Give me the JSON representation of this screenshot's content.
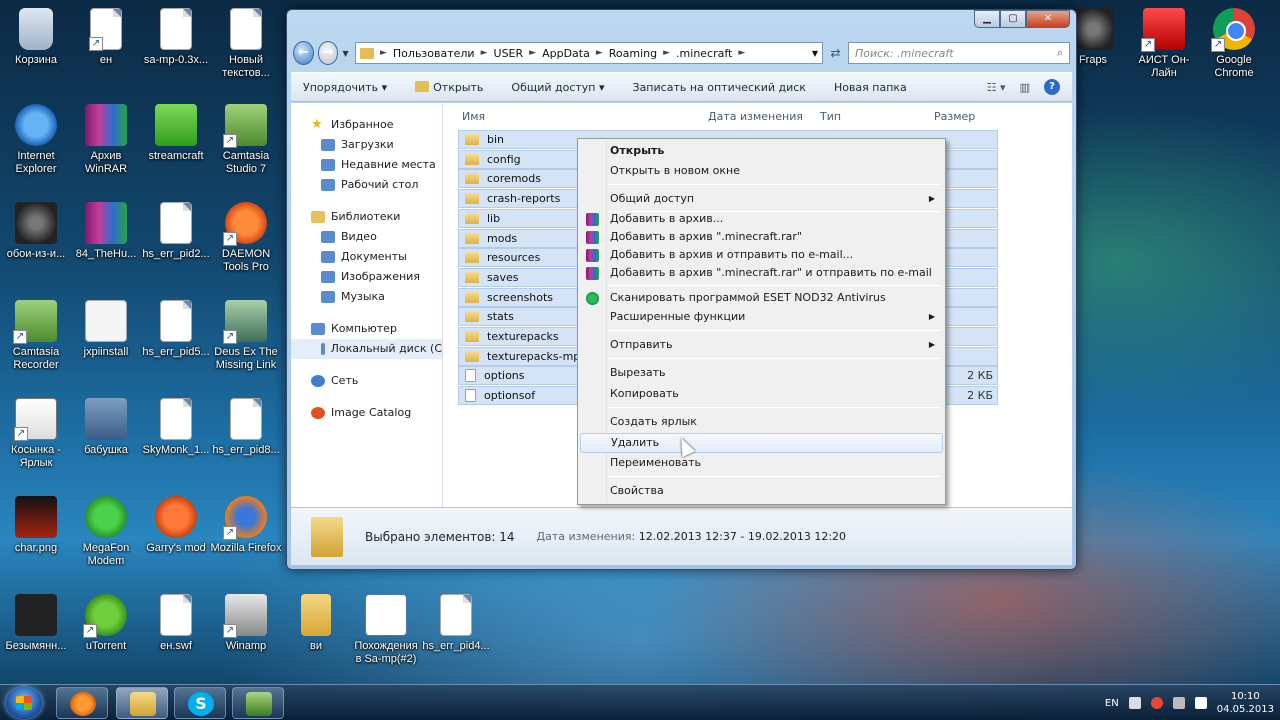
{
  "desktop": {
    "icons": [
      {
        "label": "Корзина"
      },
      {
        "label": "ен"
      },
      {
        "label": "sa-mp-0.3x..."
      },
      {
        "label": "Новый текстов..."
      },
      {
        "label": "Internet Explorer"
      },
      {
        "label": "Архив WinRAR"
      },
      {
        "label": "streamcraft"
      },
      {
        "label": "Camtasia Studio 7"
      },
      {
        "label": "обои-из-и..."
      },
      {
        "label": "84_TheHu..."
      },
      {
        "label": "hs_err_pid2..."
      },
      {
        "label": "DAEMON Tools Pro"
      },
      {
        "label": "Camtasia Recorder"
      },
      {
        "label": "jxpiinstall"
      },
      {
        "label": "hs_err_pid5..."
      },
      {
        "label": "Deus Ex The Missing Link"
      },
      {
        "label": "Косынка - Ярлык"
      },
      {
        "label": "бабушка"
      },
      {
        "label": "SkyMonk_1..."
      },
      {
        "label": "hs_err_pid8..."
      },
      {
        "label": "char.png"
      },
      {
        "label": "MegaFon Modem"
      },
      {
        "label": "Garry's mod"
      },
      {
        "label": "Mozilla Firefox"
      },
      {
        "label": "Безымянн..."
      },
      {
        "label": "uTorrent"
      },
      {
        "label": "ен.swf"
      },
      {
        "label": "Winamp"
      },
      {
        "label": "ви"
      },
      {
        "label": "Похождения в Sa-mp(#2)"
      },
      {
        "label": "hs_err_pid4..."
      },
      {
        "label": "Fraps"
      },
      {
        "label": "АИСТ Он-Лайн"
      },
      {
        "label": "Google Chrome"
      }
    ]
  },
  "window": {
    "controls": {
      "minimize": "▁",
      "maximize": "▢",
      "close": "✕"
    },
    "address": {
      "crumbs": [
        "Пользователи",
        "USER",
        "AppData",
        "Roaming",
        ".minecraft"
      ],
      "sep": "►"
    },
    "search_placeholder": "Поиск: .minecraft",
    "toolbar": {
      "organize": "Упорядочить ▾",
      "open": "Открыть",
      "share": "Общий доступ ▾",
      "burn": "Записать на оптический диск",
      "new_folder": "Новая папка"
    },
    "nav": {
      "favorites": "Избранное",
      "downloads": "Загрузки",
      "recent": "Недавние места",
      "desktop": "Рабочий стол",
      "libraries": "Библиотеки",
      "video": "Видео",
      "documents": "Документы",
      "images": "Изображения",
      "music": "Музыка",
      "computer": "Компьютер",
      "local_disk": "Локальный диск (C",
      "network": "Сеть",
      "image_catalog": "Image Catalog"
    },
    "columns": {
      "name": "Имя",
      "date": "Дата изменения",
      "type": "Тип",
      "size": "Размер"
    },
    "files": [
      {
        "name": "bin",
        "kind": "folder",
        "size": ""
      },
      {
        "name": "config",
        "kind": "folder",
        "size": ""
      },
      {
        "name": "coremods",
        "kind": "folder",
        "size": ""
      },
      {
        "name": "crash-reports",
        "kind": "folder",
        "size": ""
      },
      {
        "name": "lib",
        "kind": "folder",
        "size": ""
      },
      {
        "name": "mods",
        "kind": "folder",
        "size": ""
      },
      {
        "name": "resources",
        "kind": "folder",
        "size": ""
      },
      {
        "name": "saves",
        "kind": "folder",
        "size": ""
      },
      {
        "name": "screenshots",
        "kind": "folder",
        "size": ""
      },
      {
        "name": "stats",
        "kind": "folder",
        "size": ""
      },
      {
        "name": "texturepacks",
        "kind": "folder",
        "size": ""
      },
      {
        "name": "texturepacks-mp-ca",
        "kind": "folder",
        "size": ""
      },
      {
        "name": "options",
        "kind": "file",
        "size": "2 КБ"
      },
      {
        "name": "optionsof",
        "kind": "file",
        "size": "2 КБ"
      }
    ],
    "details": {
      "selected": "Выбрано элементов: 14",
      "date_label": "Дата изменения:",
      "date_value": "12.02.2013 12:37 - 19.02.2013 12:20"
    }
  },
  "context_menu": {
    "open": "Открыть",
    "open_new_window": "Открыть в новом окне",
    "share": "Общий доступ",
    "add_archive": "Добавить в архив...",
    "add_minecraft_rar": "Добавить в архив \".minecraft.rar\"",
    "add_archive_email": "Добавить в архив и отправить по e-mail...",
    "add_rar_email": "Добавить в архив \".minecraft.rar\" и отправить по e-mail",
    "scan_eset": "Сканировать программой ESET NOD32 Antivirus",
    "advanced": "Расширенные функции",
    "send_to": "Отправить",
    "cut": "Вырезать",
    "copy": "Копировать",
    "create_shortcut": "Создать ярлык",
    "delete": "Удалить",
    "rename": "Переименовать",
    "properties": "Свойства"
  },
  "taskbar": {
    "lang": "EN",
    "time": "10:10",
    "date": "04.05.2013",
    "skype_glyph": "S"
  }
}
